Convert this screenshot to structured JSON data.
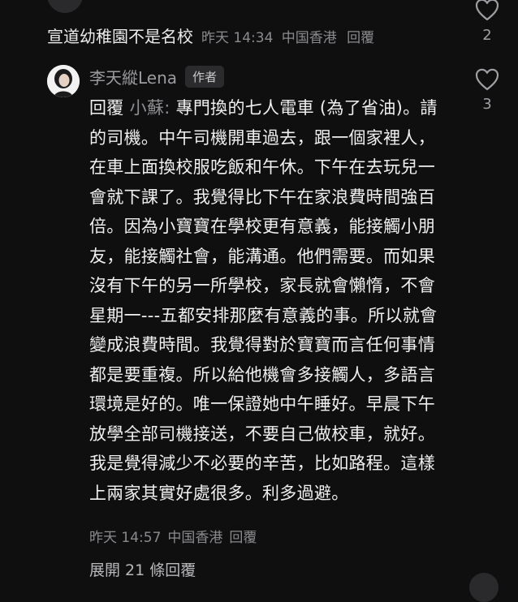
{
  "top_comment": {
    "text": "宣道幼稚園不是名校",
    "time": "昨天 14:34",
    "location": "中国香港",
    "reply_label": "回覆",
    "like_count": "2"
  },
  "reply": {
    "author": "李天縱Lena",
    "badge": "作者",
    "prefix": "回覆",
    "mention": "小蘇:",
    "body": "專門換的七人電車 (為了省油)。請的司機。中午司機開車過去，跟一個家裡人，在車上面換校服吃飯和午休。下午在去玩兒一會就下課了。我覺得比下午在家浪費時間強百倍。因為小寶寶在學校更有意義，能接觸小朋友，能接觸社會，能溝通。他們需要。而如果沒有下午的另一所學校，家長就會懶惰，不會星期一---五都安排那麼有意義的事。所以就會變成浪費時間。我覺得對於寶寶而言任何事情都是要重複。所以給他機會多接觸人，多語言環境是好的。唯一保證她中午睡好。早晨下午放學全部司機接送，不要自己做校車，就好。我是覺得減少不必要的辛苦，比如路程。這樣上兩家其實好處很多。利多過避。",
    "time": "昨天 14:57",
    "location": "中国香港",
    "reply_label": "回覆",
    "like_count": "3"
  },
  "expand_label": "展開 21 條回覆",
  "colors": {
    "background": "#0f0f10",
    "text": "#f0f0f0",
    "muted": "#8b8b8f"
  },
  "icons": {
    "like": "heart-outline-icon",
    "avatar": "user-avatar"
  }
}
